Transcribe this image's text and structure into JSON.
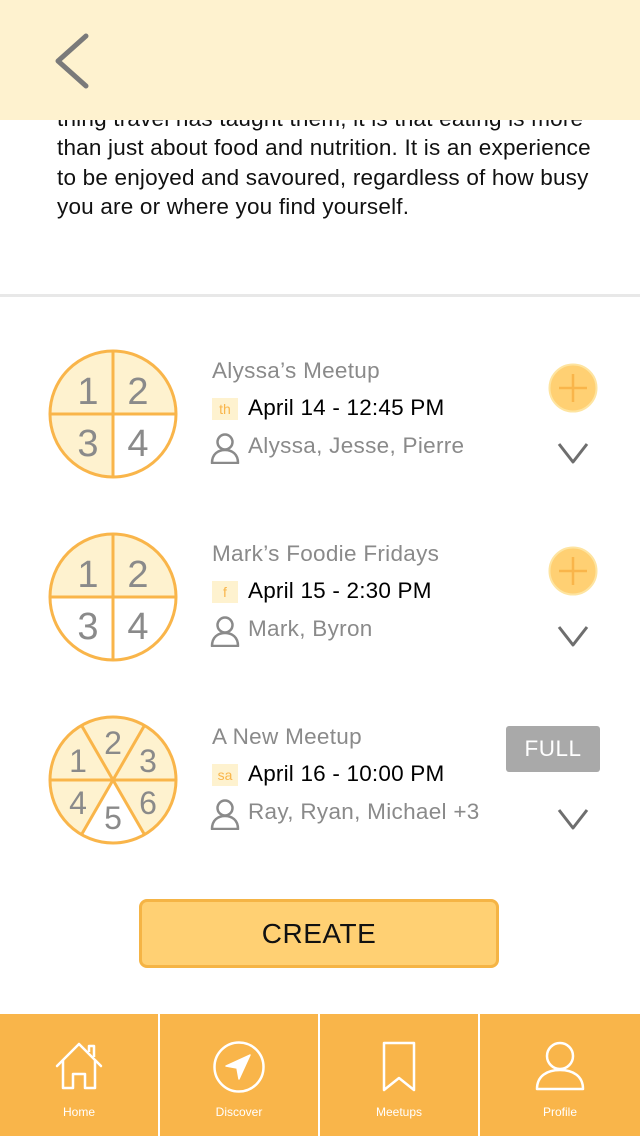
{
  "description": "thing travel has taught them, it is that eating is more than just about food and nutrition. It is an experience to be enjoyed and savoured, regardless of how busy you are or where you find yourself.",
  "meetups": [
    {
      "title": "Alyssa’s Meetup",
      "day": "th",
      "date": "April 14 - 12:45 PM",
      "people": "Alyssa, Jesse, Pierre",
      "seats": [
        "1",
        "2",
        "3",
        "4"
      ],
      "status": "join"
    },
    {
      "title": "Mark’s Foodie Fridays",
      "day": "f",
      "date": "April 15 - 2:30 PM",
      "people": "Mark, Byron",
      "seats": [
        "1",
        "2",
        "3",
        "4"
      ],
      "status": "join"
    },
    {
      "title": "A New Meetup",
      "day": "sa",
      "date": "April 16 - 10:00 PM",
      "people": "Ray, Ryan, Michael +3",
      "seats": [
        "1",
        "2",
        "3",
        "4",
        "5",
        "6"
      ],
      "status": "full",
      "full_label": "FULL"
    }
  ],
  "create_label": "CREATE",
  "nav": {
    "home": "Home",
    "discover": "Discover",
    "meetups": "Meetups",
    "profile": "Profile"
  },
  "colors": {
    "accent": "#F9B54A",
    "light": "#FEF2CF",
    "button": "#FFD073",
    "muted": "#A9A9A9"
  },
  "icons": [
    "chevron-left-icon",
    "person-icon",
    "plus-circle-icon",
    "chevron-down-icon",
    "home-icon",
    "compass-icon",
    "bookmark-icon",
    "profile-icon"
  ]
}
